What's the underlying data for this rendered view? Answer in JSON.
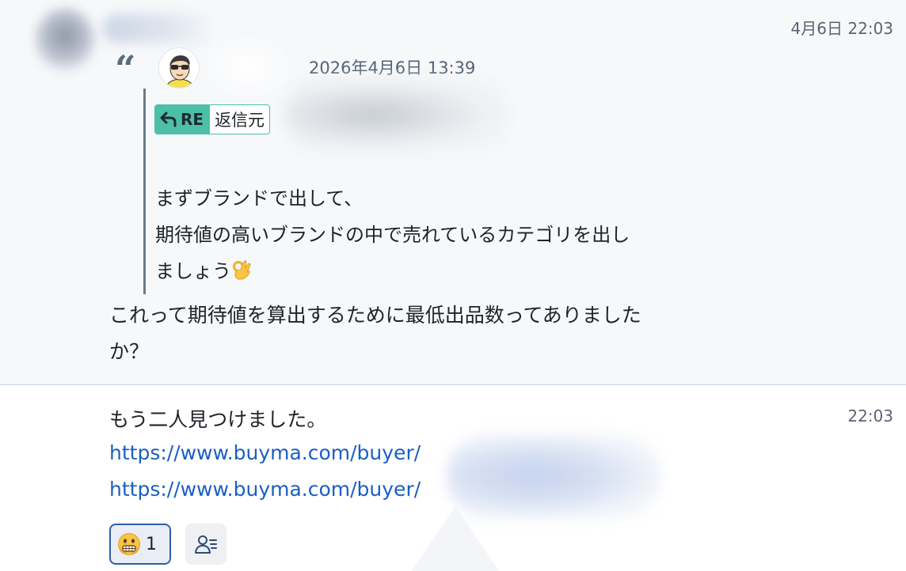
{
  "message1": {
    "time": "4月6日 22:03",
    "quote": {
      "mark": "“",
      "datetime": "2026年4月6日 13:39",
      "re_badge": {
        "tag": "RE",
        "label": "返信元"
      },
      "body_lines": [
        "まずブランドで出して、",
        "期待値の高いブランドの中で売れているカテゴリを出し",
        "ましょう"
      ],
      "emoji_icon": "ok-hand-icon"
    },
    "reply_lines": [
      "これって期待値を算出するために最低出品数ってありました",
      "か？"
    ]
  },
  "message2": {
    "time": "22:03",
    "text": "もう二人見つけました。",
    "links": [
      "https://www.buyma.com/buyer/",
      "https://www.buyma.com/buyer/"
    ],
    "reaction": {
      "icon": "grimace-emoji-icon",
      "count": "1"
    },
    "reader_icon": "reader-list-icon"
  },
  "colors": {
    "quote_bg": "#f6f8fa",
    "re_badge": "#4dbfa6",
    "link": "#1a5fc4",
    "reaction_border": "#2f5fa8"
  }
}
